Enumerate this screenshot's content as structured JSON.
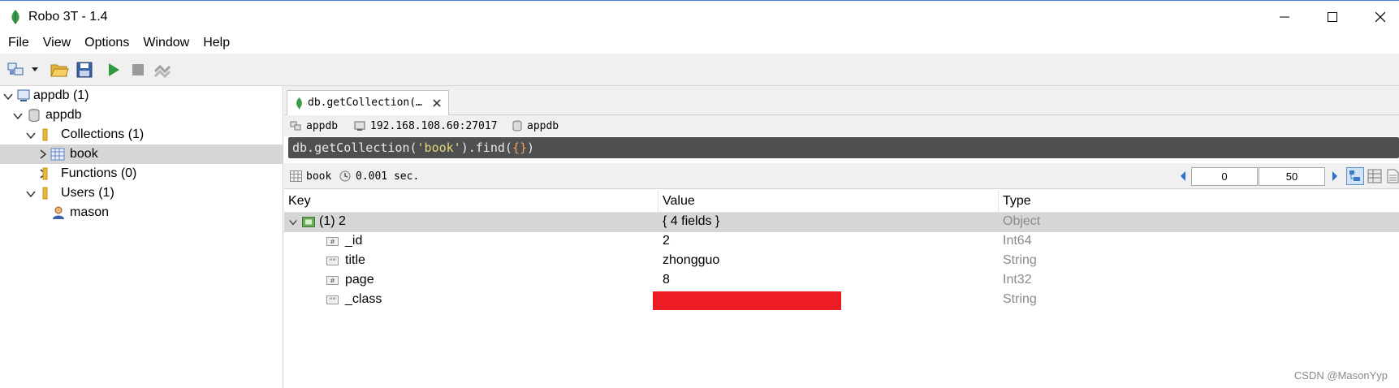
{
  "window": {
    "title": "Robo 3T - 1.4"
  },
  "menu": [
    "File",
    "View",
    "Options",
    "Window",
    "Help"
  ],
  "colors": {
    "accent": "#3a9a4a",
    "selection": "#d6d6d6",
    "query_bg": "#4d4f51",
    "redaction": "#ed1c24",
    "type_text": "#8a8a8a"
  },
  "tree": {
    "connection": "appdb (1)",
    "database": "appdb",
    "collections_folder": "Collections (1)",
    "collection": "book",
    "functions_folder": "Functions (0)",
    "users_folder": "Users (1)",
    "user": "mason"
  },
  "tab": {
    "label": "db.getCollection(…"
  },
  "connection_bar": {
    "connection": "appdb",
    "server": "192.168.108.60:27017",
    "database": "appdb"
  },
  "query": {
    "prefix": "db.getCollection(",
    "arg": "'book'",
    "middle": ").find(",
    "braces": "{}",
    "suffix": ")"
  },
  "result": {
    "collection": "book",
    "time": "0.001 sec.",
    "skip": "0",
    "limit": "50"
  },
  "grid": {
    "headers": {
      "key": "Key",
      "value": "Value",
      "type": "Type"
    },
    "rows": [
      {
        "key": "(1) 2",
        "value": "{ 4 fields }",
        "type": "Object"
      },
      {
        "key": "_id",
        "value": "2",
        "type": "Int64"
      },
      {
        "key": "title",
        "value": "zhongguo",
        "type": "String"
      },
      {
        "key": "page",
        "value": "8",
        "type": "Int32"
      },
      {
        "key": "_class",
        "value": "",
        "type": "String"
      }
    ]
  },
  "watermark": "CSDN @MasonYyp"
}
